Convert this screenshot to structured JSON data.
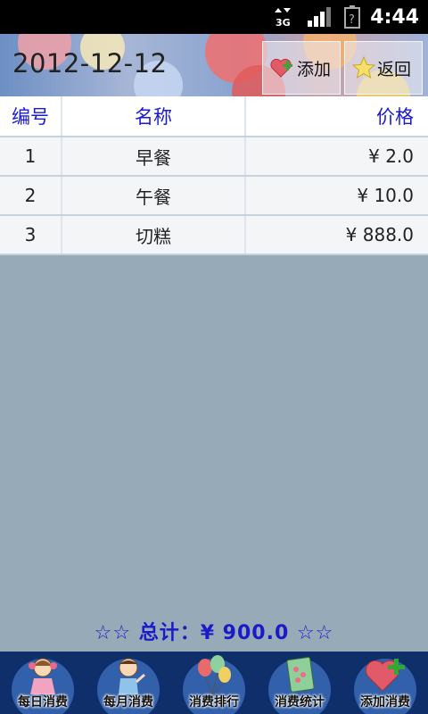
{
  "status_bar": {
    "network": "3G",
    "time": "4:44"
  },
  "header": {
    "date": "2012-12-12",
    "add_label": "添加",
    "back_label": "返回"
  },
  "table": {
    "headers": [
      "编号",
      "名称",
      "价格"
    ],
    "rows": [
      {
        "no": "1",
        "name": "早餐",
        "price": "¥ 2.0"
      },
      {
        "no": "2",
        "name": "午餐",
        "price": "¥ 10.0"
      },
      {
        "no": "3",
        "name": "切糕",
        "price": "¥ 888.0"
      }
    ]
  },
  "total": {
    "text": "☆☆  总计：¥ 900.0  ☆☆"
  },
  "bottom_nav": {
    "items": [
      {
        "label": "每日消费",
        "icon": "girl-icon"
      },
      {
        "label": "每月消费",
        "icon": "boy-icon"
      },
      {
        "label": "消费排行",
        "icon": "balloons-icon"
      },
      {
        "label": "消费统计",
        "icon": "notebook-icon"
      },
      {
        "label": "添加消费",
        "icon": "heart-plus-icon"
      }
    ]
  },
  "colors": {
    "background": "#97aab8",
    "header_text": "#1a1acc",
    "total_text": "#1a1ac8",
    "nav_background": "#0f2f6a"
  }
}
